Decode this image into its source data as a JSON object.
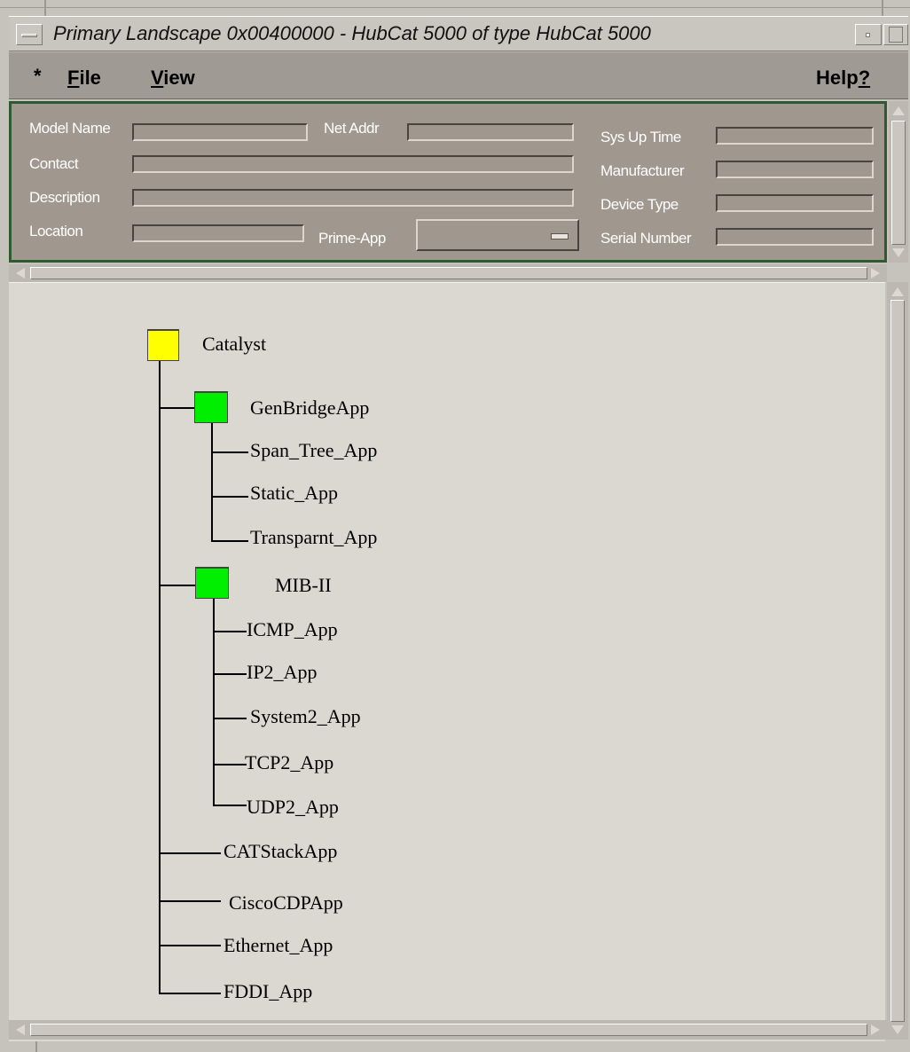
{
  "window": {
    "title": "Primary Landscape 0x00400000 - HubCat 5000 of type HubCat 5000"
  },
  "menubar": {
    "star": "*",
    "file": {
      "accel": "F",
      "rest": "ile"
    },
    "view": {
      "accel": "V",
      "rest": "iew"
    },
    "help": {
      "pre": "Help",
      "accel": "?"
    }
  },
  "info": {
    "model_name": "Model Name",
    "net_addr": "Net Addr",
    "sys_up_time": "Sys Up Time",
    "contact": "Contact",
    "manufacturer": "Manufacturer",
    "description": "Description",
    "device_type": "Device Type",
    "location": "Location",
    "prime_app": "Prime-App",
    "serial_number": "Serial Number"
  },
  "tree": {
    "root": "Catalyst",
    "genbridge": "GenBridgeApp",
    "span_tree": "Span_Tree_App",
    "static": "Static_App",
    "transparnt": "Transparnt_App",
    "mib2": "MIB-II",
    "icmp": "ICMP_App",
    "ip2": "IP2_App",
    "system2": "System2_App",
    "tcp2": "TCP2_App",
    "udp2": "UDP2_App",
    "catstack": "CATStackApp",
    "ciscocdp": "CiscoCDPApp",
    "ethernet": "Ethernet_App",
    "fddi": "FDDI_App"
  },
  "colors": {
    "root_node": "#ffff00",
    "app_node": "#00ee00",
    "info_panel": "#a0978e",
    "info_border": "#2f5a2f"
  }
}
